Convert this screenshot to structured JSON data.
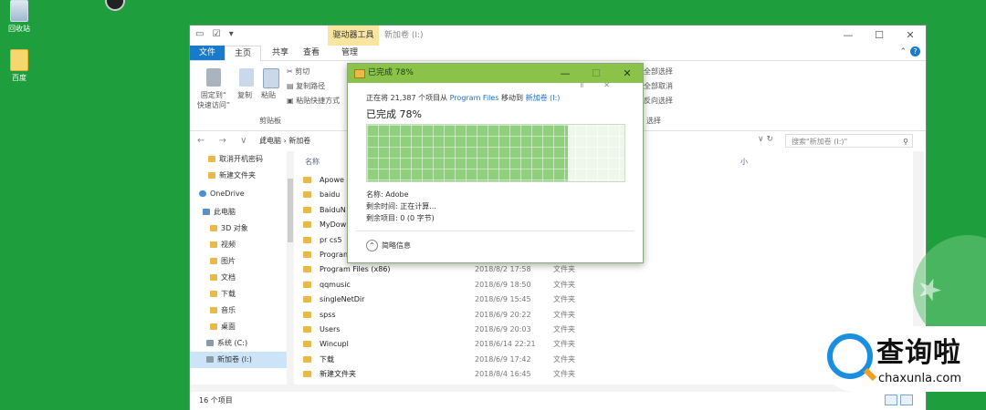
{
  "desktop": {
    "icons": [
      {
        "label": "回收站",
        "icon": "recycle-bin-icon"
      },
      {
        "label": "百度",
        "icon": "baidu-icon"
      }
    ]
  },
  "explorer": {
    "title": "新加卷 (I:)",
    "context_tab": "驱动器工具",
    "window_buttons": {
      "minimize": "—",
      "maximize": "☐",
      "close": "✕"
    },
    "tabs": {
      "file": "文件",
      "home": "主页",
      "share": "共享",
      "view": "查看",
      "manage": "管理"
    },
    "ribbon": {
      "pin_label": "固定到“\n快速访问”",
      "copy_label": "复制",
      "paste_label": "粘贴",
      "cut_label": "剪切",
      "copy_path_label": "复制路径",
      "paste_shortcut_label": "粘贴快捷方式",
      "clipboard_group": "剪贴板",
      "select_all": "全部选择",
      "select_none": "全部取消",
      "invert_select": "反向选择",
      "select_group": "选择"
    },
    "address": {
      "path": "此电脑 › 新加卷",
      "search_placeholder": "搜索\"新加卷 (I:)\""
    },
    "nav": [
      {
        "label": "取消开机密码",
        "type": "folder"
      },
      {
        "label": "新建文件夹",
        "type": "folder"
      },
      {
        "label": "OneDrive",
        "type": "cloud"
      },
      {
        "label": "此电脑",
        "type": "pc"
      },
      {
        "label": "3D 对象",
        "type": "folder"
      },
      {
        "label": "视频",
        "type": "folder"
      },
      {
        "label": "图片",
        "type": "folder"
      },
      {
        "label": "文档",
        "type": "folder"
      },
      {
        "label": "下载",
        "type": "folder"
      },
      {
        "label": "音乐",
        "type": "folder"
      },
      {
        "label": "桌面",
        "type": "folder"
      },
      {
        "label": "系统 (C:)",
        "type": "drive"
      },
      {
        "label": "新加卷 (I:)",
        "type": "drive"
      }
    ],
    "columns": {
      "name": "名称",
      "size": "小"
    },
    "files": [
      {
        "name": "Apowe",
        "date": "",
        "type": ""
      },
      {
        "name": "baidu",
        "date": "",
        "type": ""
      },
      {
        "name": "BaiduN",
        "date": "",
        "type": ""
      },
      {
        "name": "MyDow",
        "date": "",
        "type": ""
      },
      {
        "name": "pr cs5",
        "date": "",
        "type": ""
      },
      {
        "name": "Progran",
        "date": "",
        "type": ""
      },
      {
        "name": "Program Files (x86)",
        "date": "2018/8/2 17:58",
        "type": "文件夹"
      },
      {
        "name": "qqmusic",
        "date": "2018/6/9 18:50",
        "type": "文件夹"
      },
      {
        "name": "singleNetDir",
        "date": "2018/6/9 15:45",
        "type": "文件夹"
      },
      {
        "name": "spss",
        "date": "2018/6/9 20:22",
        "type": "文件夹"
      },
      {
        "name": "Users",
        "date": "2018/6/9 20:03",
        "type": "文件夹"
      },
      {
        "name": "Wincupl",
        "date": "2018/6/14 22:21",
        "type": "文件夹"
      },
      {
        "name": "下载",
        "date": "2018/6/9 17:42",
        "type": "文件夹"
      },
      {
        "name": "新建文件夹",
        "date": "2018/8/4 16:45",
        "type": "文件夹"
      }
    ],
    "status": {
      "count": "16 个项目"
    }
  },
  "dialog": {
    "title": "已完成 78%",
    "line1_prefix": "正在将 21,387 个项目从 ",
    "source": "Program Files",
    "line1_mid": " 移动到 ",
    "dest": "新加卷 (I:)",
    "percent_text": "已完成 78%",
    "progress": 0.78,
    "name_line": "名称: Adobe",
    "time_line": "剩余时间: 正在计算...",
    "items_line": "剩余项目: 0 (0 字节)",
    "less_info": "简略信息",
    "buttons": {
      "minimize": "—",
      "maximize": "☐",
      "close": "✕"
    }
  },
  "watermark": {
    "brand": "查询啦",
    "site": "chaxunla.com"
  }
}
